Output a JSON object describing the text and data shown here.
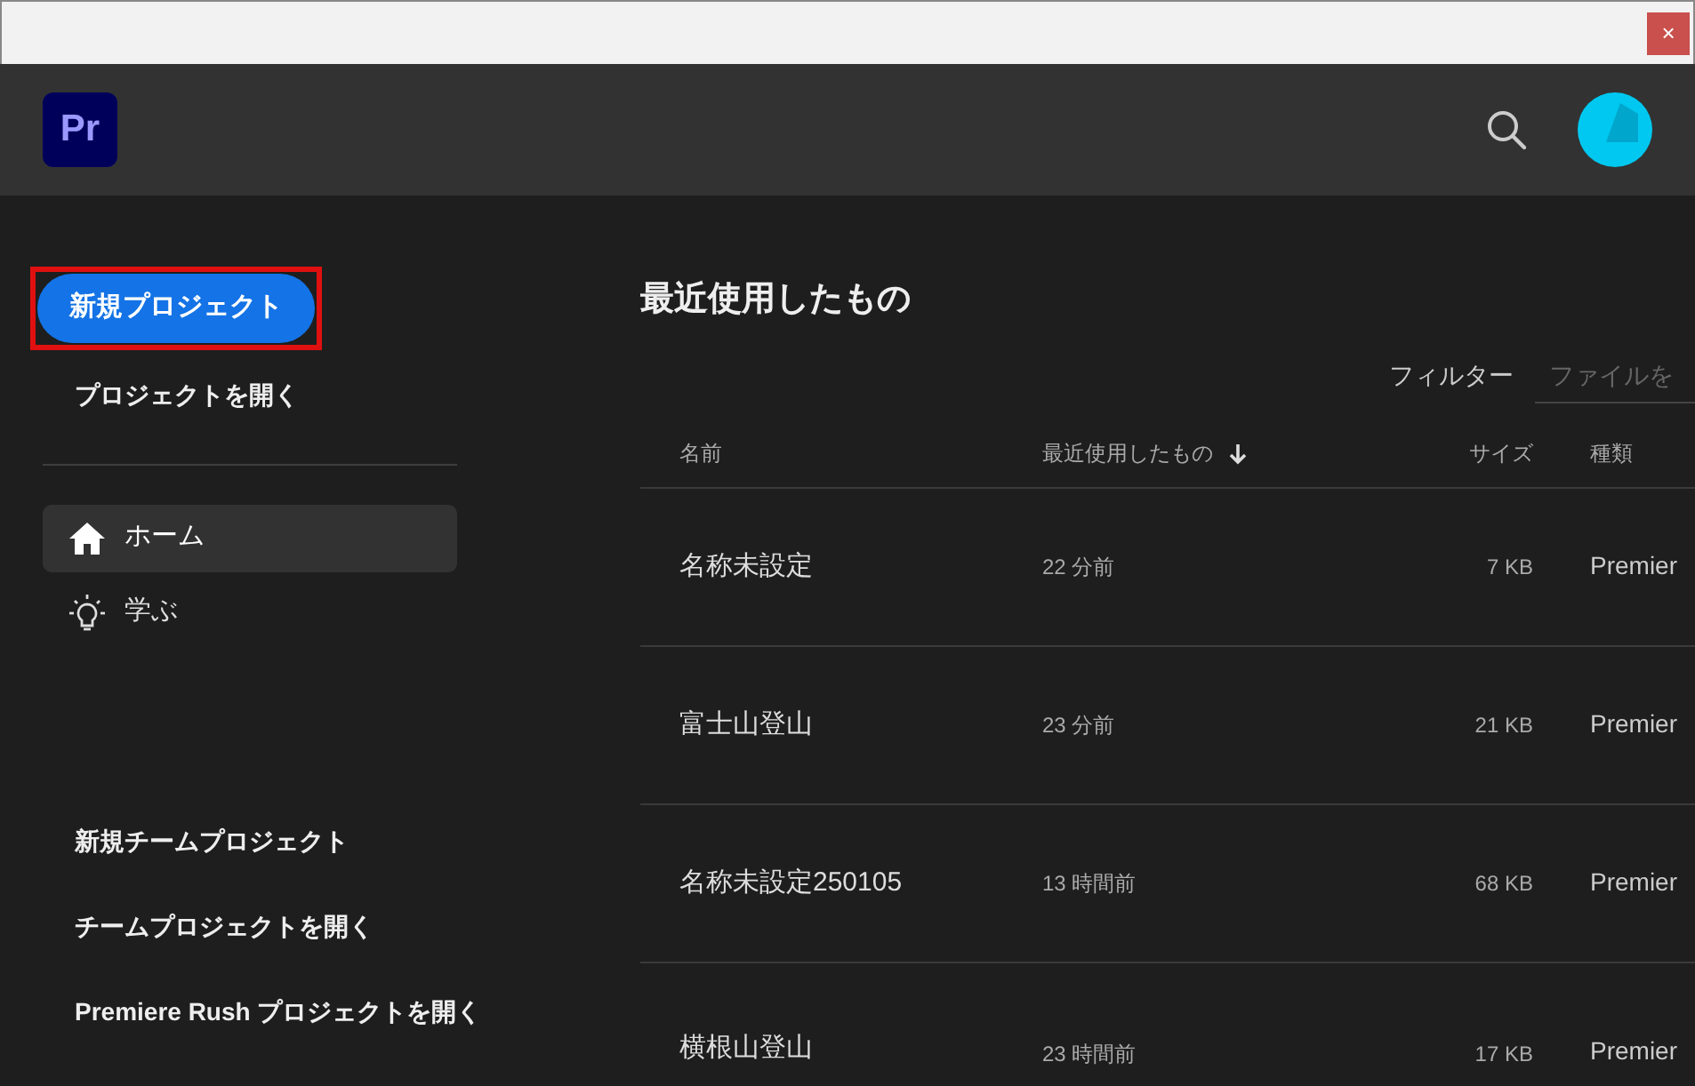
{
  "window": {
    "close_label": "×"
  },
  "header": {
    "logo": "Pr"
  },
  "sidebar": {
    "primary_button": {
      "label": "新規プロジェクト",
      "highlighted": true
    },
    "open_link": "プロジェクトを開く",
    "nav": [
      {
        "label": "ホーム",
        "kind": "home",
        "selected": true
      },
      {
        "label": "学ぶ",
        "kind": "learn",
        "selected": false
      }
    ],
    "links": [
      "新規チームプロジェクト",
      "チームプロジェクトを開く",
      "Premiere Rush プロジェクトを開く"
    ]
  },
  "main": {
    "title": "最近使用したもの",
    "filter_label": "フィルター",
    "filter": {
      "placeholder": "ファイルを"
    },
    "columns": [
      {
        "label": "名前",
        "sorted": false
      },
      {
        "label": "最近使用したもの",
        "sorted": true
      },
      {
        "label": "サイズ",
        "sorted": false
      },
      {
        "label": "種類",
        "sorted": false
      }
    ],
    "rows": [
      {
        "name": "名称未設定",
        "modified": "22 分前",
        "size": "7 KB",
        "type": "Premier"
      },
      {
        "name": "富士山登山",
        "modified": "23 分前",
        "size": "21 KB",
        "type": "Premier"
      },
      {
        "name": "名称未設定250105",
        "modified": "13 時間前",
        "size": "68 KB",
        "type": "Premier"
      },
      {
        "name": "横根山登山",
        "modified": "23 時間前",
        "size": "17 KB",
        "type": "Premier"
      }
    ]
  }
}
